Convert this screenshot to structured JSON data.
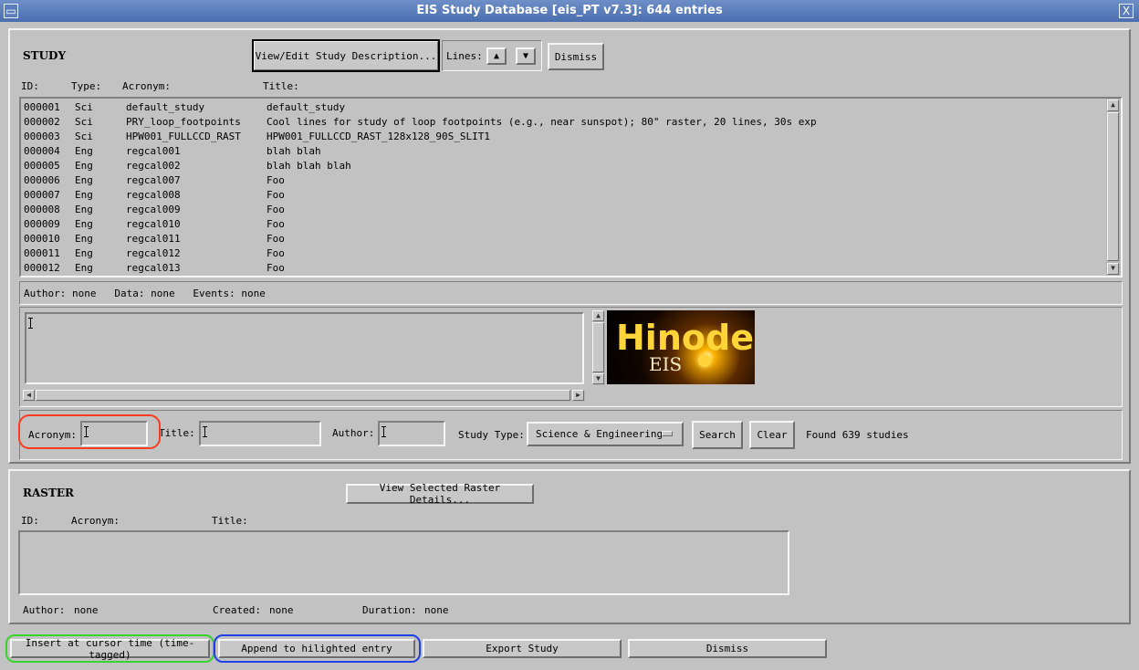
{
  "window": {
    "title": "EIS Study Database  [eis_PT v7.3]:  644 entries",
    "close_glyph": "X"
  },
  "study": {
    "heading": "STUDY",
    "view_edit_label": "View/Edit Study Description...",
    "lines_label": "Lines:",
    "dismiss_label": "Dismiss",
    "columns": {
      "id": "ID:",
      "type": "Type:",
      "acronym": "Acronym:",
      "title": "Title:"
    },
    "rows": [
      {
        "id": "000001",
        "type": "Sci",
        "acronym": "default_study",
        "title": "default_study"
      },
      {
        "id": "000002",
        "type": "Sci",
        "acronym": "PRY_loop_footpoints",
        "title": "Cool lines for study of loop footpoints (e.g., near sunspot); 80\" raster, 20 lines, 30s exp"
      },
      {
        "id": "000003",
        "type": "Sci",
        "acronym": "HPW001_FULLCCD_RAST",
        "title": "HPW001_FULLCCD_RAST_128x128_90S_SLIT1"
      },
      {
        "id": "000004",
        "type": "Eng",
        "acronym": "regcal001",
        "title": "blah blah"
      },
      {
        "id": "000005",
        "type": "Eng",
        "acronym": "regcal002",
        "title": "blah blah blah"
      },
      {
        "id": "000006",
        "type": "Eng",
        "acronym": "regcal007",
        "title": "Foo"
      },
      {
        "id": "000007",
        "type": "Eng",
        "acronym": "regcal008",
        "title": "Foo"
      },
      {
        "id": "000008",
        "type": "Eng",
        "acronym": "regcal009",
        "title": "Foo"
      },
      {
        "id": "000009",
        "type": "Eng",
        "acronym": "regcal010",
        "title": "Foo"
      },
      {
        "id": "000010",
        "type": "Eng",
        "acronym": "regcal011",
        "title": "Foo"
      },
      {
        "id": "000011",
        "type": "Eng",
        "acronym": "regcal012",
        "title": "Foo"
      },
      {
        "id": "000012",
        "type": "Eng",
        "acronym": "regcal013",
        "title": "Foo"
      }
    ],
    "info": "Author: none   Data: none   Events: none",
    "logo": {
      "main": "Hinode",
      "sub": "EIS"
    },
    "search": {
      "acronym_label": "Acronym:",
      "acronym_value": "",
      "title_label": "Title:",
      "title_value": "",
      "author_label": "Author:",
      "author_value": "",
      "study_type_label": "Study Type:",
      "study_type_value": "Science & Engineering",
      "search_label": "Search",
      "clear_label": "Clear",
      "found_text": "Found 639 studies"
    }
  },
  "raster": {
    "heading": "RASTER",
    "view_details_label": "View Selected Raster Details...",
    "columns": {
      "id": "ID:",
      "acronym": "Acronym:",
      "title": "Title:"
    },
    "author_label": "Author:",
    "author_value": "none",
    "created_label": "Created:",
    "created_value": "none",
    "duration_label": "Duration:",
    "duration_value": "none"
  },
  "bottom": {
    "insert_label": "Insert at cursor time (time-tagged)",
    "append_label": "Append to hilighted entry",
    "export_label": "Export Study",
    "dismiss_label": "Dismiss"
  },
  "colors": {
    "highlight_red": "#ff3b1f",
    "highlight_green": "#37d42c",
    "highlight_blue": "#1f3fe8"
  }
}
